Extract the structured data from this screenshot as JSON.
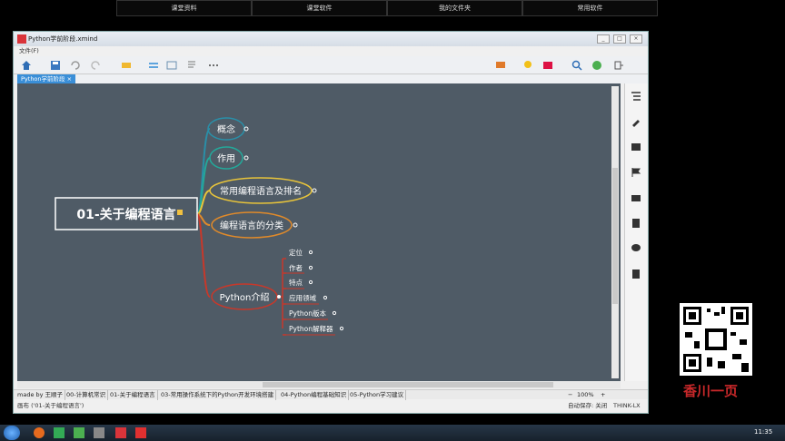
{
  "top_nav": [
    "课堂资料",
    "课堂软件",
    "我的文件夹",
    "常用软件"
  ],
  "window": {
    "title": "Python学前阶段.xmind",
    "menu_file": "文件(F)",
    "doc_tab": "Python学前阶段",
    "tab_close": "×"
  },
  "mindmap": {
    "root": "01-关于编程语言",
    "branches": [
      {
        "label": "概念",
        "color": "#2a8fa8"
      },
      {
        "label": "作用",
        "color": "#24a89a"
      },
      {
        "label": "常用编程语言及排名",
        "color": "#e8c43a"
      },
      {
        "label": "编程语言的分类",
        "color": "#e08a2a"
      },
      {
        "label": "Python介绍",
        "color": "#c8382a"
      }
    ],
    "sub": [
      "定位",
      "作者",
      "特点",
      "应用领域",
      "Python版本",
      "Python解释器"
    ]
  },
  "sheets": [
    "made by 王顺子",
    "00-计算机常识",
    "01-关于编程语言",
    "03-常用操作系统下的Python开发环境搭建",
    "04-Python编程基础知识",
    "05-Python学习建议"
  ],
  "zoom": {
    "minus": "−",
    "value": "100%",
    "plus": "+"
  },
  "status": {
    "left": "画布 ('01-关于编程语言')",
    "autosave": "自动保存: 关闭",
    "user": "THINK-LX"
  },
  "brand": "香川一页",
  "clock": "11:35",
  "colors": {
    "canvas": "#4f5b66",
    "tab_active": "#3a8fd8",
    "accent_red": "#c8282a"
  }
}
